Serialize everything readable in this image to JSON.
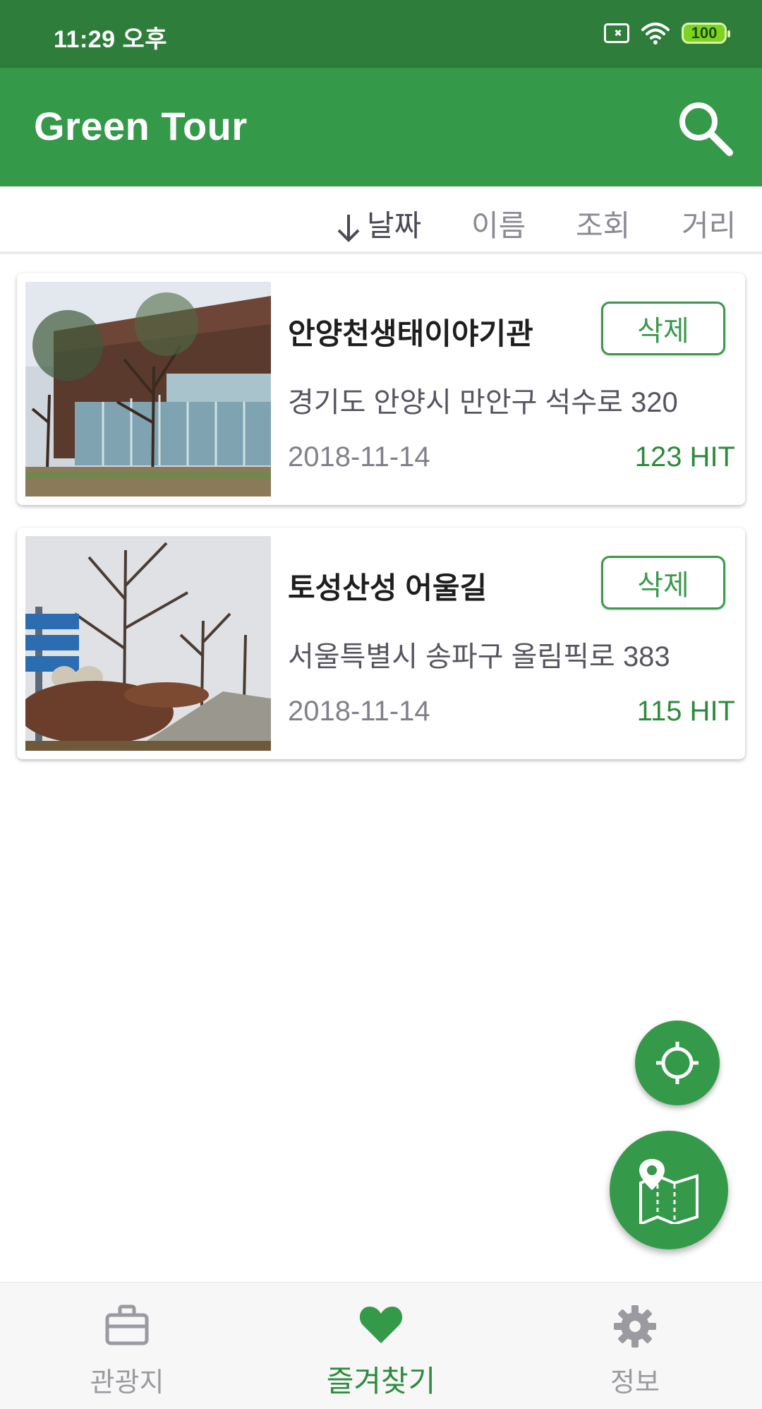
{
  "status_bar": {
    "time": "11:29 오후",
    "battery": "100"
  },
  "app_bar": {
    "title": "Green Tour",
    "search_icon": "search-icon"
  },
  "sort": {
    "items": [
      {
        "label": "날짜",
        "active": true,
        "icon": "arrow-down-icon"
      },
      {
        "label": "이름",
        "active": false
      },
      {
        "label": "조회",
        "active": false
      },
      {
        "label": "거리",
        "active": false
      }
    ]
  },
  "favorites": [
    {
      "title": "안양천생태이야기관",
      "address": "경기도 안양시 만안구 석수로 320",
      "date": "2018-11-14",
      "hits": "123 HIT",
      "delete_label": "삭제"
    },
    {
      "title": "토성산성 어울길",
      "address": "서울특별시 송파구 올림픽로 383",
      "date": "2018-11-14",
      "hits": "115 HIT",
      "delete_label": "삭제"
    }
  ],
  "fabs": {
    "location_icon": "crosshair-icon",
    "map_icon": "map-pin-icon"
  },
  "bottom_nav": {
    "items": [
      {
        "label": "관광지",
        "icon": "briefcase-icon",
        "active": false
      },
      {
        "label": "즐겨찾기",
        "icon": "heart-icon",
        "active": true
      },
      {
        "label": "정보",
        "icon": "gear-icon",
        "active": false
      }
    ]
  },
  "colors": {
    "status_bar": "#2e7d3b",
    "primary": "#35994a",
    "accent_text": "#2e8b3e"
  }
}
